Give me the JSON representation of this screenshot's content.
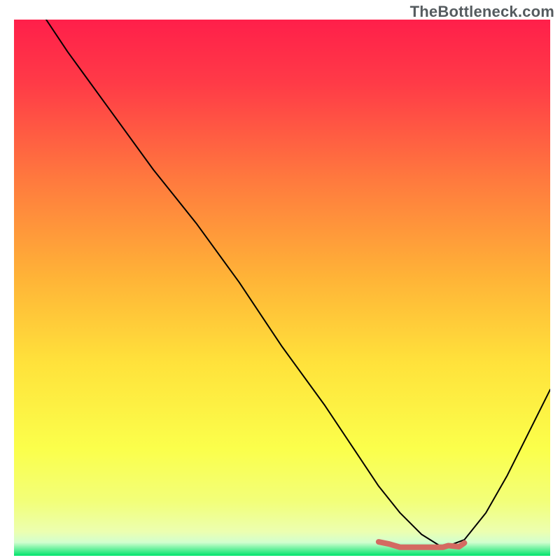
{
  "watermark": "TheBottleneck.com",
  "chart_data": {
    "type": "line",
    "title": "",
    "xlabel": "",
    "ylabel": "",
    "xlim": [
      0,
      100
    ],
    "ylim": [
      0,
      100
    ],
    "grid": false,
    "legend": false,
    "background_gradient": {
      "type": "vertical",
      "stops": [
        {
          "pos": 0.0,
          "color": "#ff1f4a"
        },
        {
          "pos": 0.12,
          "color": "#ff3b47"
        },
        {
          "pos": 0.3,
          "color": "#ff7a3e"
        },
        {
          "pos": 0.48,
          "color": "#ffb337"
        },
        {
          "pos": 0.64,
          "color": "#ffe23b"
        },
        {
          "pos": 0.8,
          "color": "#fbff4b"
        },
        {
          "pos": 0.9,
          "color": "#f2ff7a"
        },
        {
          "pos": 0.955,
          "color": "#ecffb0"
        },
        {
          "pos": 0.975,
          "color": "#d2ffcf"
        },
        {
          "pos": 1.0,
          "color": "#00e36b"
        }
      ]
    },
    "series": [
      {
        "name": "bottleneck-curve",
        "color": "#000000",
        "width": 2,
        "x": [
          6,
          10,
          18,
          26,
          30,
          34,
          42,
          50,
          58,
          64,
          68,
          72,
          76,
          80,
          84,
          88,
          92,
          96,
          100
        ],
        "y": [
          100,
          94,
          83,
          72,
          67,
          62,
          51,
          39,
          28,
          19,
          13,
          8,
          4,
          1.5,
          3,
          8,
          15,
          23,
          31
        ]
      },
      {
        "name": "optimal-range-marker",
        "color": "#d46a62",
        "width": 8,
        "x": [
          68,
          70,
          72,
          74,
          76,
          78,
          80,
          81,
          83,
          84
        ],
        "y": [
          2.6,
          2.2,
          1.6,
          1.6,
          1.6,
          1.6,
          1.6,
          1.9,
          1.7,
          2.4
        ]
      }
    ]
  }
}
